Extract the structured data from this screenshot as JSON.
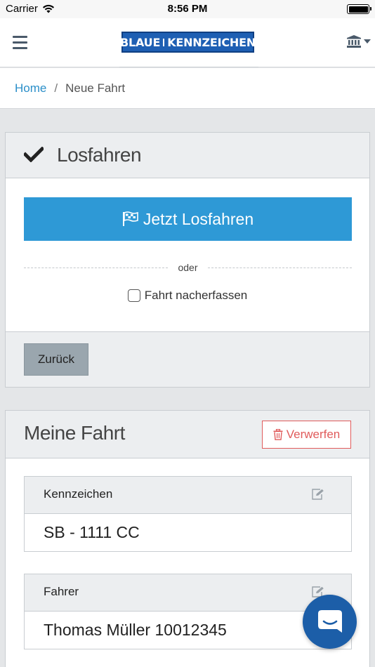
{
  "status_bar": {
    "carrier": "Carrier",
    "time": "8:56 PM",
    "battery_percent": 100
  },
  "navbar": {
    "brand_left": "BLAUE",
    "brand_right": "KENNZEICHEN",
    "menu_icon": "hamburger-icon",
    "account_icon": "bank-icon"
  },
  "breadcrumb": {
    "home": "Home",
    "separator": "/",
    "current": "Neue Fahrt"
  },
  "start_card": {
    "title": "Losfahren",
    "title_icon": "checkmark-icon",
    "start_button_label": "Jetzt Losfahren",
    "start_button_icon": "checkered-flag-icon",
    "divider_text": "oder",
    "checkbox_label": "Fahrt nacherfassen",
    "checkbox_checked": false,
    "back_button_label": "Zurück"
  },
  "trip_card": {
    "title": "Meine Fahrt",
    "discard_label": "Verwerfen",
    "discard_icon": "trash-icon",
    "fields": [
      {
        "label": "Kennzeichen",
        "value": "SB - 1111 CC",
        "icon": "edit-icon"
      },
      {
        "label": "Fahrer",
        "value": "Thomas Müller 10012345",
        "icon": "edit-icon"
      }
    ]
  },
  "chat": {
    "icon": "chat-bubble-icon"
  },
  "colors": {
    "primary": "#2e99d6",
    "link": "#2b8fc9",
    "danger": "#e05b5b",
    "brand": "#1e5fb3",
    "chat": "#1c5ea8"
  }
}
